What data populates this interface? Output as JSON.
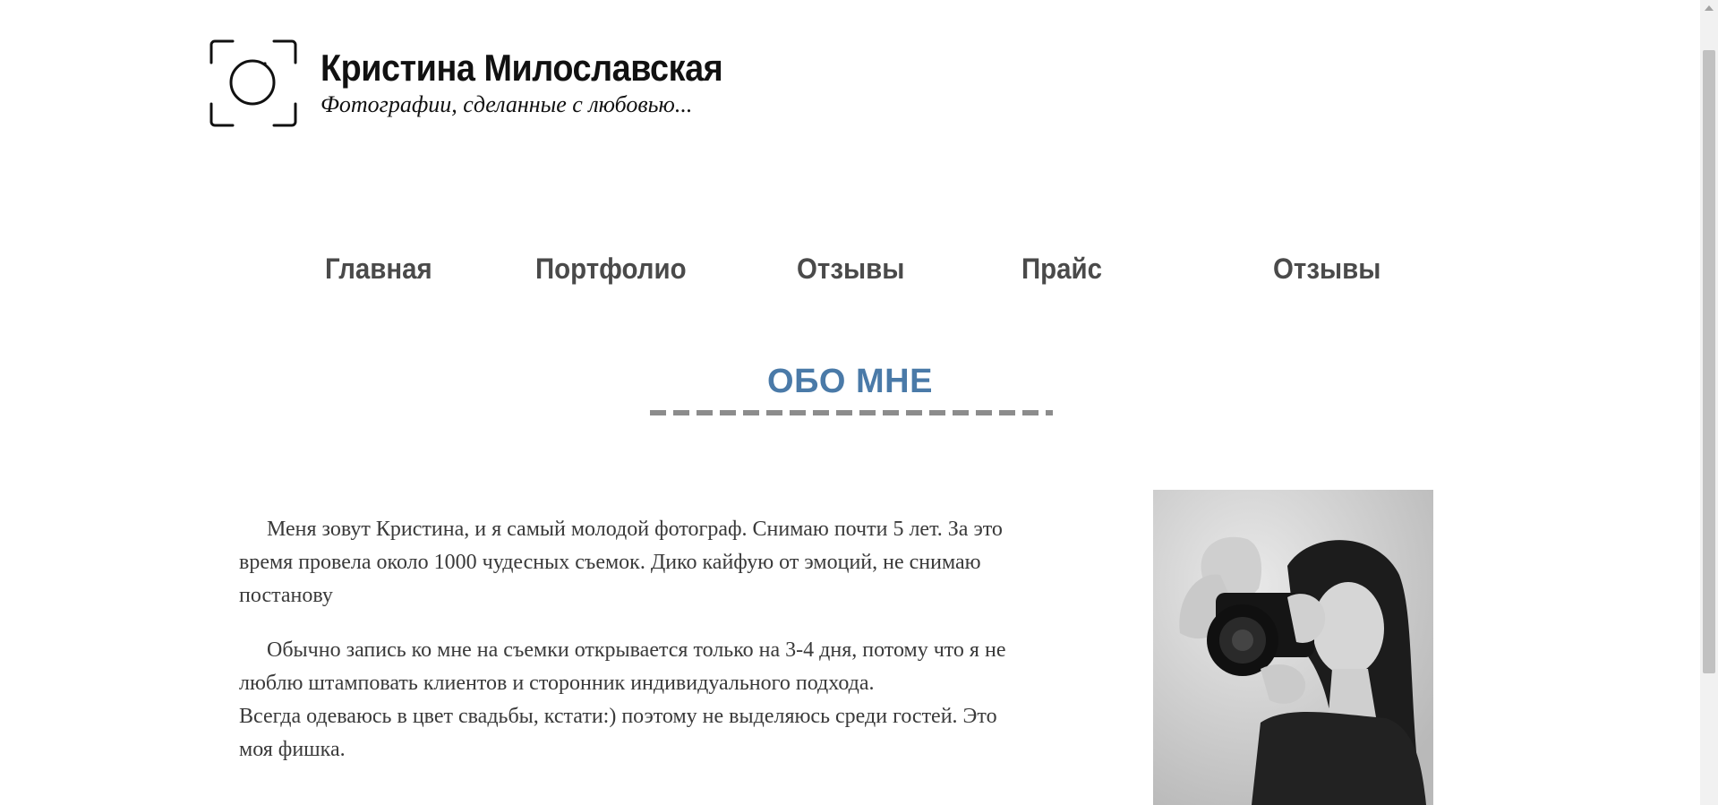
{
  "header": {
    "title": "Кристина Милославская",
    "tagline": "Фотографии, сделанные с любовью...",
    "logo_icon": "camera-frame-icon"
  },
  "nav": {
    "items": [
      {
        "label": "Главная"
      },
      {
        "label": "Портфолио"
      },
      {
        "label": "Отзывы"
      },
      {
        "label": "Прайс"
      },
      {
        "label": "Отзывы"
      }
    ]
  },
  "about": {
    "title": "ОБО МНЕ",
    "paragraphs": [
      "Меня зовут Кристина, и я самый молодой фотограф. Снимаю почти 5 лет. За это время провела около 1000 чудесных съемок. Дико кайфую от эмоций, не снимаю постанову",
      "Обычно запись ко мне на съемки открывается только на 3-4 дня, потому что я не люблю штамповать клиентов и сторонник индивидуального подхода.",
      "Всегда одеваюсь в цвет свадьбы, кстати:) поэтому не выделяюсь среди гостей. Это моя фишка."
    ]
  },
  "colors": {
    "accent": "#4a7aa8",
    "nav_text": "#4a4a4a",
    "body_text": "#3a3a3a",
    "divider": "#8c8c8c"
  }
}
